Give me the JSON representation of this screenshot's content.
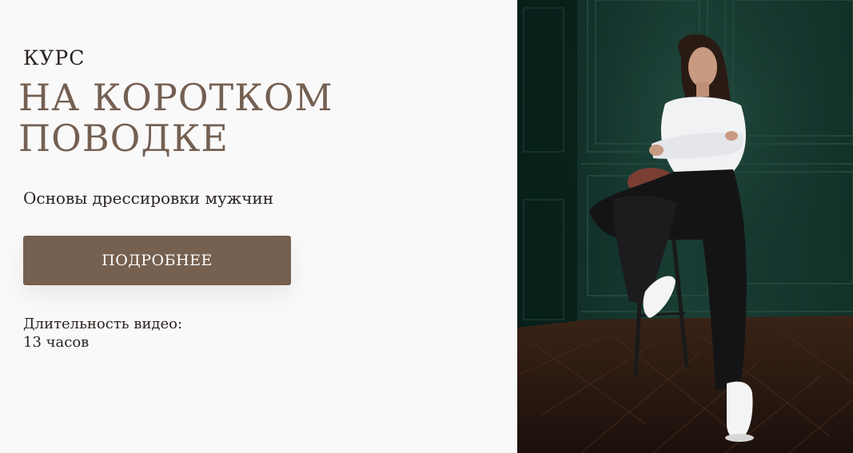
{
  "hero": {
    "eyebrow": "КУРС",
    "title_line1": "НА КОРОТКОМ",
    "title_line2": "ПОВОДКЕ",
    "subtitle": "Основы дрессировки мужчин",
    "cta_label": "ПОДРОБНЕЕ",
    "duration_label": "Длительность видео:",
    "duration_value": "13 часов"
  },
  "colors": {
    "accent": "#76604f",
    "title": "#746052",
    "text": "#2a2421",
    "background": "#faf9f9",
    "wall": "#173a30",
    "floor": "#2b1a12"
  }
}
